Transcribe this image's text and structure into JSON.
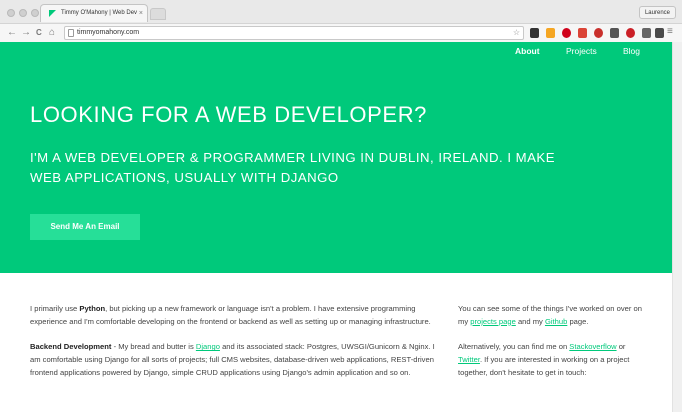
{
  "browser": {
    "tab_title": "Timmy O'Mahony | Web Dev",
    "tab_close": "×",
    "profile_name": "Laurence",
    "url": "timmyomahony.com",
    "back_glyph": "←",
    "forward_glyph": "→",
    "reload_glyph": "C",
    "home_glyph": "⌂",
    "star_glyph": "☆",
    "menu_glyph": "≡",
    "extensions": [
      "layers-icon",
      "rss-icon",
      "opera-icon",
      "gmail-icon",
      "record-icon",
      "pocket-icon",
      "pinterest-icon",
      "shield-icon",
      "evernote-icon",
      "reader-icon"
    ]
  },
  "nav": {
    "items": [
      {
        "label": "About",
        "active": true
      },
      {
        "label": "Projects",
        "active": false
      },
      {
        "label": "Blog",
        "active": false
      }
    ]
  },
  "hero": {
    "title": "LOOKING FOR A WEB DEVELOPER?",
    "subtitle": "I'M A WEB DEVELOPER & PROGRAMMER LIVING IN DUBLIN, IRELAND. I MAKE WEB APPLICATIONS, USUALLY WITH DJANGO",
    "cta": "Send Me An Email"
  },
  "content": {
    "p1_a": "I primarily use ",
    "p1_bold": "Python",
    "p1_b": ", but picking up a new framework or language isn't a problem. I have extensive programming experience and I'm comfortable developing on the frontend or backend as well as setting up or managing infrastructure.",
    "p2_bold": "Backend Development",
    "p2_a": " - My bread and butter is ",
    "p2_link": "Django",
    "p2_b": " and its associated stack: Postgres, UWSGI/Gunicorn & Nginx. I am comfortable using Django for all sorts of projects; full CMS websites, database-driven web applications, REST-driven frontend applications powered by Django, simple CRUD applications using Django's admin application and so on.",
    "r1_a": "You can see some of the things I've worked on over on my ",
    "r1_link1": "projects page",
    "r1_b": " and my ",
    "r1_link2": "Github",
    "r1_c": " page.",
    "r2_a": "Alternatively, you can find me on ",
    "r2_link1": "Stackoverflow",
    "r2_b": " or ",
    "r2_link2": "Twitter",
    "r2_c": ". If you are interested in working on a project together, don't hesitate to get in touch:"
  },
  "colors": {
    "accent": "#00c97b",
    "button": "#26df98"
  }
}
